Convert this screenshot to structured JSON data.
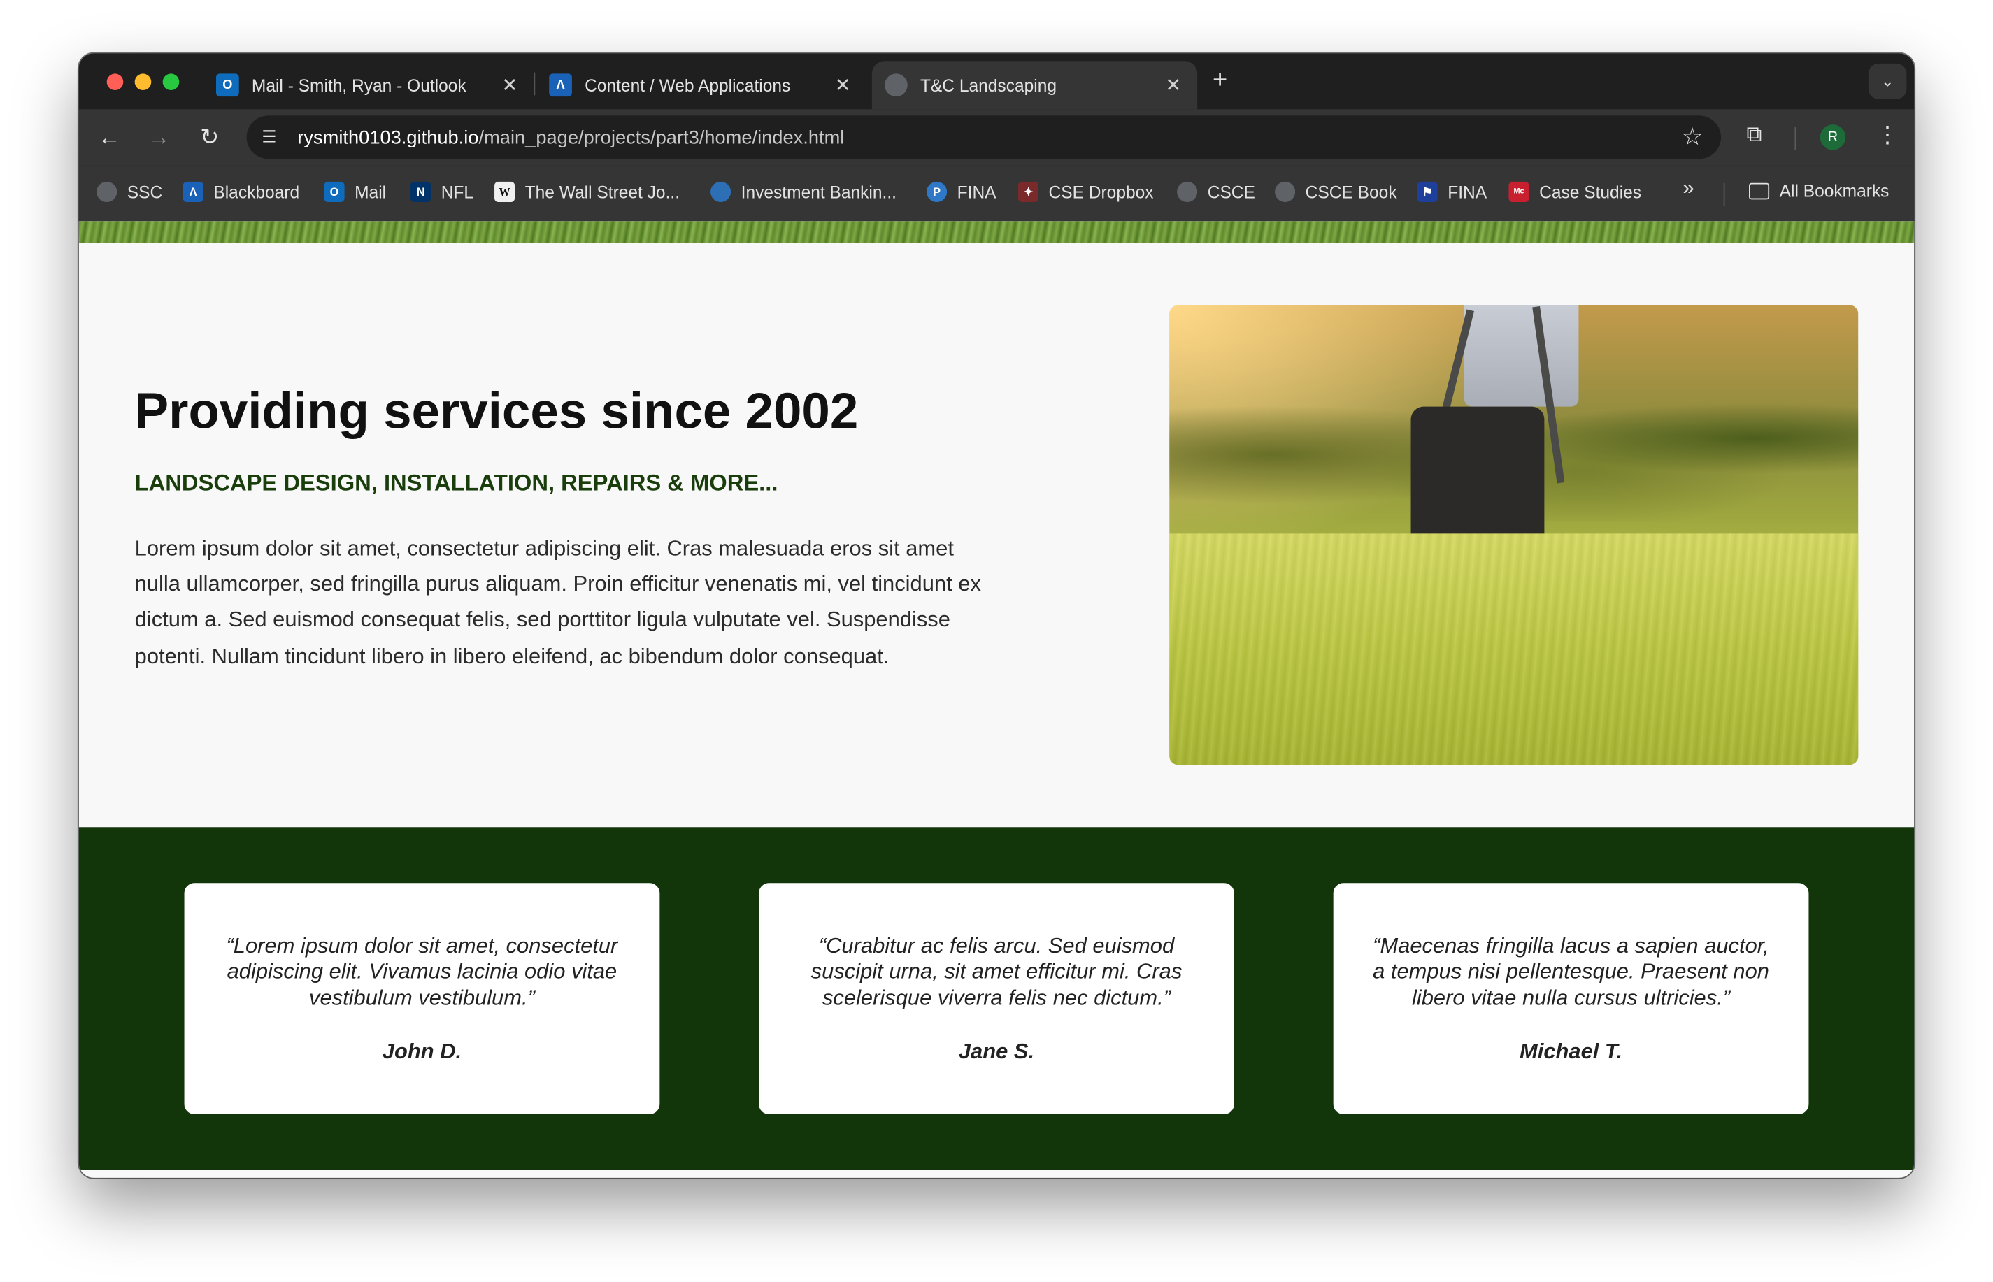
{
  "browser": {
    "tabs": [
      {
        "title": "Mail - Smith, Ryan - Outlook",
        "favicon": "outlook-icon"
      },
      {
        "title": "Content / Web Applications",
        "favicon": "blackboard-icon"
      },
      {
        "title": "T&C Landscaping",
        "favicon": "globe-icon",
        "active": true
      }
    ],
    "url_host": "rysmith0103.github.io",
    "url_path": "/main_page/projects/part3/home/index.html",
    "profile_initial": "R",
    "bookmarks": [
      {
        "label": "SSC",
        "icon": "globe-icon"
      },
      {
        "label": "Blackboard",
        "icon": "blackboard-icon"
      },
      {
        "label": "Mail",
        "icon": "outlook-icon"
      },
      {
        "label": "NFL",
        "icon": "nfl-icon"
      },
      {
        "label": "The Wall Street Jo...",
        "icon": "wsj-icon"
      },
      {
        "label": "Investment Bankin...",
        "icon": "globe-icon"
      },
      {
        "label": "FINA",
        "icon": "pearson-icon"
      },
      {
        "label": "CSE Dropbox",
        "icon": "dropbox-icon"
      },
      {
        "label": "CSCE",
        "icon": "globe-icon"
      },
      {
        "label": "CSCE Book",
        "icon": "globe-icon"
      },
      {
        "label": "FINA",
        "icon": "bookmark-icon"
      },
      {
        "label": "Case Studies",
        "icon": "mcgraw-hill-icon"
      }
    ],
    "overflow_label": "»",
    "all_bookmarks": "All Bookmarks"
  },
  "hero": {
    "title": "Providing services since 2002",
    "subtitle": "LANDSCAPE DESIGN, INSTALLATION, REPAIRS & MORE...",
    "body": "Lorem ipsum dolor sit amet, consectetur adipiscing elit. Cras malesuada eros sit amet nulla ullamcorper, sed fringilla purus aliquam. Proin efficitur venenatis mi, vel tincidunt ex dictum a. Sed euismod consequat felis, sed porttitor ligula vulputate vel. Suspendisse potenti. Nullam tincidunt libero in libero eleifend, ac bibendum dolor consequat."
  },
  "testimonials": [
    {
      "quote": "“Lorem ipsum dolor sit amet, consectetur adipiscing elit. Vivamus lacinia odio vitae vestibulum vestibulum.”",
      "author": "John D."
    },
    {
      "quote": "“Curabitur ac felis arcu. Sed euismod suscipit urna, sit amet efficitur mi. Cras scelerisque viverra felis nec dictum.”",
      "author": "Jane S."
    },
    {
      "quote": "“Maecenas fringilla lacus a sapien auctor, a tempus nisi pellentesque. Praesent non libero vitae nulla cursus ultricies.”",
      "author": "Michael T."
    }
  ],
  "colors": {
    "brand_green": "#12360a",
    "subtitle_green": "#1a3d0c"
  }
}
